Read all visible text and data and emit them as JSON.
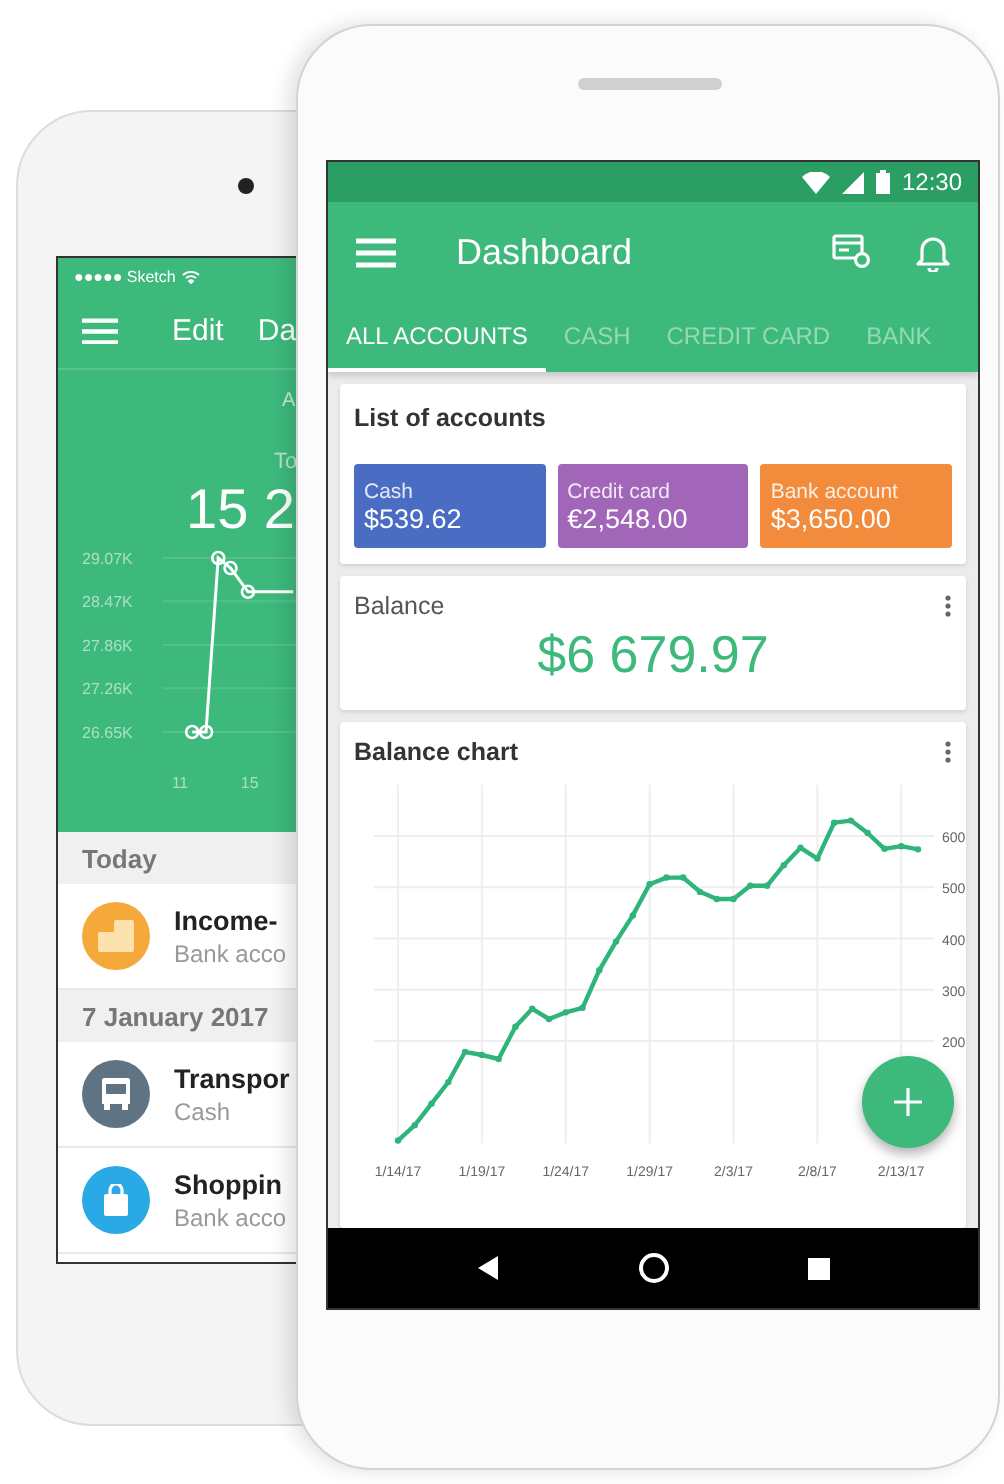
{
  "back_phone": {
    "status_bar": {
      "carrier": "●●●●● Sketch"
    },
    "app_bar": {
      "items": [
        "Edit",
        "Da"
      ]
    },
    "tab": "A",
    "total_label": "To",
    "total": "15 2",
    "chart_data": {
      "type": "line",
      "x": [
        11.7,
        12.5,
        13.2,
        13.9,
        14.9,
        17.5
      ],
      "series": [
        {
          "color": "#ffffff",
          "marker": "circle",
          "values": [
            26.65,
            26.65,
            29.07,
            28.93,
            28.6,
            28.6
          ]
        }
      ],
      "xlim": [
        10,
        18
      ],
      "ylim": [
        26.65,
        29.07
      ],
      "grid": true,
      "xticks": [
        11,
        15
      ],
      "yticks": [
        {
          "value": 29.07,
          "label": "29.07K"
        },
        {
          "value": 28.47,
          "label": "28.47K"
        },
        {
          "value": 27.86,
          "label": "27.86K"
        },
        {
          "value": 27.26,
          "label": "27.26K"
        },
        {
          "value": 26.65,
          "label": "26.65K"
        }
      ]
    },
    "transactions": [
      {
        "date": "Today",
        "items": [
          {
            "title": "Income-",
            "subtitle": "Bank acco",
            "color": "#f5a93b",
            "kind": "coins"
          }
        ]
      },
      {
        "date": "7 January 2017",
        "items": [
          {
            "title": "Transpor",
            "subtitle": "Cash",
            "color": "#5f7383",
            "kind": "bus"
          },
          {
            "title": "Shoppin",
            "subtitle": "Bank acco",
            "color": "#29a9e6",
            "kind": "bag"
          }
        ]
      }
    ]
  },
  "front_phone": {
    "status_bar": {
      "time": "12:30"
    },
    "app_bar": {
      "title": "Dashboard"
    },
    "tabs": [
      {
        "label": "ALL ACCOUNTS",
        "selected": true
      },
      {
        "label": "CASH",
        "selected": false
      },
      {
        "label": "CREDIT CARD",
        "selected": false
      },
      {
        "label": "BANK",
        "selected": false
      }
    ],
    "accounts_card": {
      "title": "List of accounts",
      "accounts": [
        {
          "name": "Cash",
          "amount": "$539.62",
          "color": "#4a6cc2"
        },
        {
          "name": "Credit card",
          "amount": "€2,548.00",
          "color": "#a266b9"
        },
        {
          "name": "Bank account",
          "amount": "$3,650.00",
          "color": "#f28b3c"
        }
      ]
    },
    "balance_card": {
      "title": "Balance",
      "amount": "$6 679.97"
    },
    "chart_card": {
      "title": "Balance chart",
      "chart_data": {
        "type": "line",
        "categories": [
          "1/14/17",
          null,
          null,
          null,
          null,
          "1/19/17",
          null,
          null,
          null,
          null,
          "1/24/17",
          null,
          null,
          null,
          null,
          "1/29/17",
          null,
          null,
          null,
          null,
          "2/3/17",
          null,
          null,
          null,
          null,
          "2/8/17",
          null,
          null,
          null,
          null,
          "2/13/17",
          null
        ],
        "series": [
          {
            "color": "#2fb57a",
            "marker": "circle",
            "values": [
              6,
              36,
              78,
              120,
              179,
              173,
              165,
              228,
              263,
              243,
              256,
              265,
              338,
              394,
              445,
              506,
              519,
              519,
              491,
              477,
              477,
              503,
              503,
              543,
              577,
              556,
              626,
              630,
              606,
              575,
              580,
              574
            ]
          }
        ],
        "ylim": [
          0,
          700
        ],
        "grid": true,
        "yticks": [
          200,
          300,
          400,
          500,
          600
        ]
      }
    }
  }
}
